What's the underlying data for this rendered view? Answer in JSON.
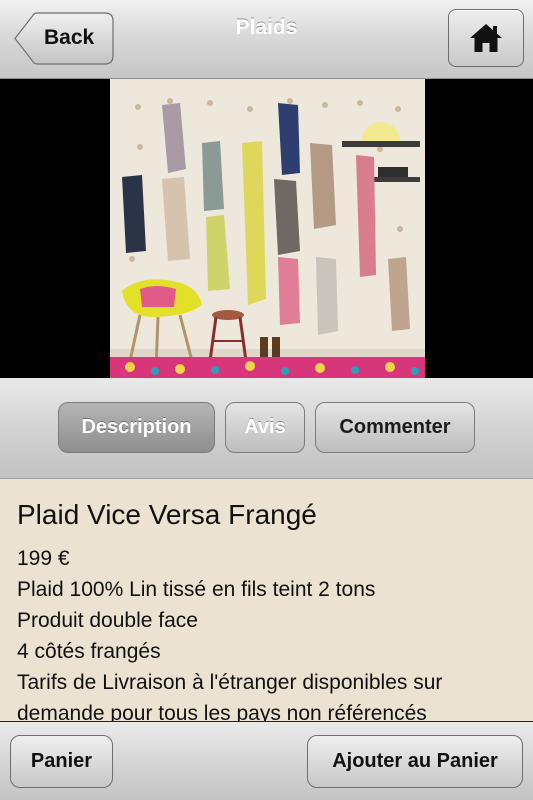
{
  "navbar": {
    "title": "Plaids",
    "back_label": "Back",
    "home_icon": "home-icon"
  },
  "product_image": {
    "icon": "product-photo"
  },
  "tabs": [
    {
      "label": "Description",
      "active": true
    },
    {
      "label": "Avis",
      "active": false
    },
    {
      "label": "Commenter",
      "active": false
    }
  ],
  "product": {
    "title": "Plaid Vice Versa Frangé",
    "lines": [
      "199 €",
      "Plaid 100% Lin tissé en fils teint 2 tons",
      "Produit double face",
      "4 côtés frangés",
      "Tarifs de Livraison à l'étranger disponibles sur",
      "demande pour tous les pays non référencés"
    ]
  },
  "bottom": {
    "cart_label": "Panier",
    "add_label": "Ajouter au Panier"
  },
  "colors": {
    "content_bg": "#ebe2d1",
    "active_tab": "#9e9e9e"
  }
}
